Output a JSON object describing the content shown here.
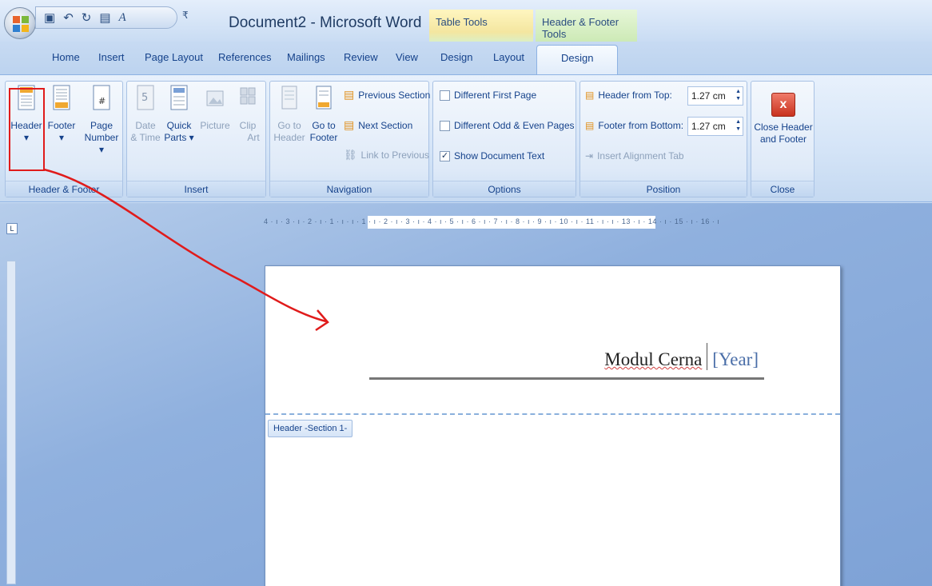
{
  "window": {
    "title": "Document2 - Microsoft Word"
  },
  "quick_access": {
    "more_glyph": "₹"
  },
  "contextual_tabs": [
    {
      "label": "Table Tools"
    },
    {
      "label": "Header & Footer Tools"
    }
  ],
  "tabs": [
    {
      "label": "Home"
    },
    {
      "label": "Insert"
    },
    {
      "label": "Page Layout"
    },
    {
      "label": "References"
    },
    {
      "label": "Mailings"
    },
    {
      "label": "Review"
    },
    {
      "label": "View"
    },
    {
      "label": "Design"
    },
    {
      "label": "Layout"
    },
    {
      "label": "Design"
    }
  ],
  "ribbon": {
    "header_footer": {
      "label": "Header & Footer",
      "header": "Header",
      "header_arrow": "▾",
      "footer": "Footer",
      "footer_arrow": "▾",
      "page": "Page",
      "number": "Number ▾"
    },
    "insert": {
      "label": "Insert",
      "date": "Date",
      "time": "& Time",
      "quick": "Quick",
      "parts": "Parts ▾",
      "picture": "Picture",
      "clip": "Clip",
      "art": "Art"
    },
    "navigation": {
      "label": "Navigation",
      "goto1": "Go to",
      "header": "Header",
      "goto2": "Go to",
      "footer": "Footer",
      "previous": "Previous Section",
      "next": "Next Section",
      "link": "Link to Previous"
    },
    "options": {
      "label": "Options",
      "first": "Different First Page",
      "oddeven": "Different Odd & Even Pages",
      "show": "Show Document Text",
      "show_checked": true
    },
    "position": {
      "label": "Position",
      "header_top": "Header from Top:",
      "header_top_value": "1.27 cm",
      "footer_bottom": "Footer from Bottom:",
      "footer_bottom_value": "1.27 cm",
      "align": "Insert Alignment Tab"
    },
    "close": {
      "label": "Close",
      "line1": "Close Header",
      "line2": "and Footer"
    }
  },
  "ruler": {
    "corner": "L",
    "text": "4 · ı · 3 · ı · 2 · ı · 1 · ı  ·  ı · 1 · ı · 2 · ı · 3 · ı · 4 · ı · 5 · ı · 6 · ı · 7 · ı · 8 · ı · 9 · ı · 10 · ı · 11 · ı  · ı · 13 · ı · 14  · ı · 15 · ı · 16 · ı"
  },
  "document": {
    "header_name": "Modul Cerna",
    "header_year": "[Year]",
    "section_tag": "Header -Section 1-"
  },
  "colors": {
    "ribbon_text": "#15428b",
    "annotation_red": "#e01b1b",
    "year_placeholder": "#4a6ea8"
  }
}
